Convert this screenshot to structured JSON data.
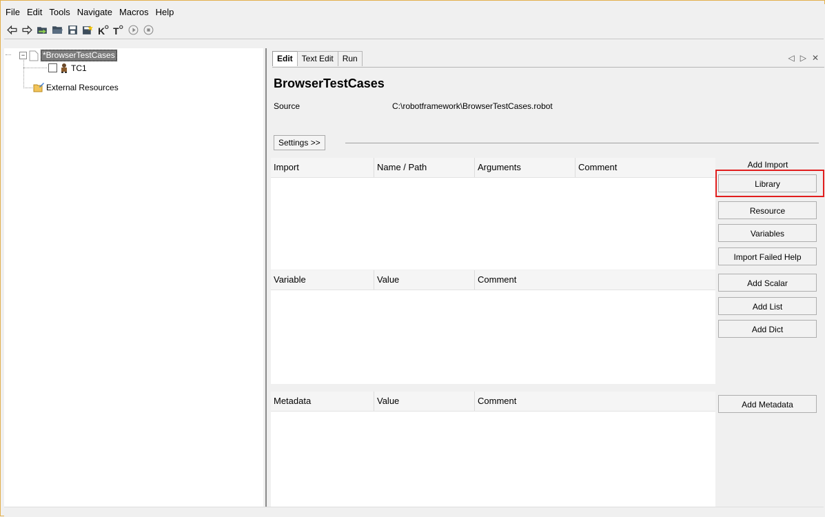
{
  "menu": [
    "File",
    "Edit",
    "Tools",
    "Navigate",
    "Macros",
    "Help"
  ],
  "toolbar": {
    "icons": [
      "back-arrow-icon",
      "forward-arrow-icon",
      "open-suite-icon",
      "open-folder-icon",
      "save-icon",
      "save-all-icon",
      "search-keywords-icon",
      "search-tests-icon",
      "run-icon",
      "stop-icon"
    ]
  },
  "tree": {
    "suite": "*BrowserTestCases",
    "test_case": "TC1",
    "external": "External Resources"
  },
  "tabs": [
    "Edit",
    "Text Edit",
    "Run"
  ],
  "tab_controls": [
    "◁",
    "▷",
    "✕"
  ],
  "editor": {
    "title": "BrowserTestCases",
    "source_label": "Source",
    "source_value": "C:\\robotframework\\BrowserTestCases.robot",
    "settings_button": "Settings >>"
  },
  "imports_table": {
    "columns": [
      "Import",
      "Name / Path",
      "Arguments",
      "Comment"
    ]
  },
  "variables_table": {
    "columns": [
      "Variable",
      "Value",
      "Comment"
    ]
  },
  "metadata_table": {
    "columns": [
      "Metadata",
      "Value",
      "Comment"
    ]
  },
  "side_buttons": {
    "add_import_label": "Add Import",
    "library": "Library",
    "resource": "Resource",
    "variables": "Variables",
    "import_failed_help": "Import Failed Help",
    "add_scalar": "Add Scalar",
    "add_list": "Add List",
    "add_dict": "Add Dict",
    "add_metadata": "Add Metadata"
  },
  "colors": {
    "highlight": "#e11d1d",
    "selected_node_bg": "#7a7a7a",
    "window_border": "#e3b04b"
  }
}
